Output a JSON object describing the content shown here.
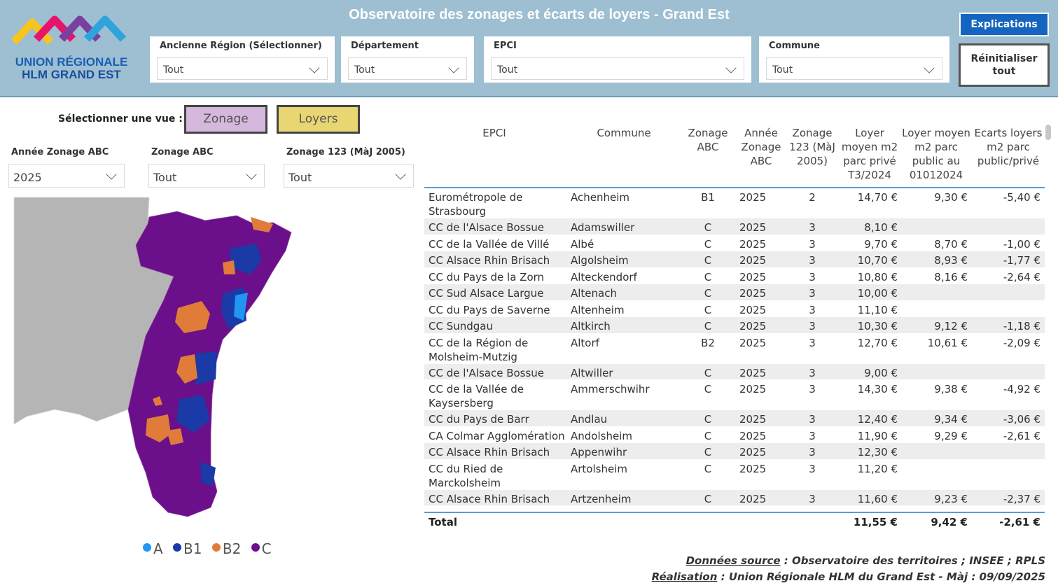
{
  "header": {
    "logo_line1": "UNION RÉGIONALE",
    "logo_line2": "HLM GRAND EST",
    "title": "Observatoire des zonages et écarts de loyers - Grand Est",
    "filters": [
      {
        "label": "Ancienne Région (Sélectionner)",
        "value": "Tout"
      },
      {
        "label": "Département",
        "value": "Tout"
      },
      {
        "label": "EPCI",
        "value": "Tout"
      },
      {
        "label": "Commune",
        "value": "Tout"
      }
    ],
    "explications_label": "Explications",
    "reset_label": "Réinitialiser tout"
  },
  "view": {
    "label": "Sélectionner une vue :",
    "zonage_label": "Zonage",
    "loyers_label": "Loyers"
  },
  "slicers": [
    {
      "label": "Année Zonage ABC",
      "value": "2025"
    },
    {
      "label": "Zonage ABC",
      "value": "Tout"
    },
    {
      "label": "Zonage 123 (MàJ 2005)",
      "value": "Tout"
    }
  ],
  "legend": [
    {
      "label": "A",
      "color": "#2196f3"
    },
    {
      "label": "B1",
      "color": "#1a3aa8"
    },
    {
      "label": "B2",
      "color": "#e07b39"
    },
    {
      "label": "C",
      "color": "#6b0f8a"
    }
  ],
  "table": {
    "headers": {
      "epci": "EPCI",
      "commune": "Commune",
      "zabc": "Zonage ABC",
      "annee": "Année Zonage ABC",
      "z123": "Zonage 123 (MàJ 2005)",
      "lpriv": "Loyer moyen m2 parc privé T3/2024",
      "lpub": "Loyer moyen m2 parc public au 01012024",
      "ecart": "Ecarts loyers m2 parc public/privé"
    },
    "rows": [
      {
        "epci": "Eurométropole de Strasbourg",
        "commune": "Achenheim",
        "zabc": "B1",
        "annee": "2025",
        "z123": "2",
        "lpriv": "14,70 €",
        "lpub": "9,30 €",
        "ecart": "-5,40 €"
      },
      {
        "epci": "CC de l'Alsace Bossue",
        "commune": "Adamswiller",
        "zabc": "C",
        "annee": "2025",
        "z123": "3",
        "lpriv": "8,10 €",
        "lpub": "",
        "ecart": ""
      },
      {
        "epci": "CC de la Vallée de Villé",
        "commune": "Albé",
        "zabc": "C",
        "annee": "2025",
        "z123": "3",
        "lpriv": "9,70 €",
        "lpub": "8,70 €",
        "ecart": "-1,00 €"
      },
      {
        "epci": "CC Alsace Rhin Brisach",
        "commune": "Algolsheim",
        "zabc": "C",
        "annee": "2025",
        "z123": "3",
        "lpriv": "10,70 €",
        "lpub": "8,93 €",
        "ecart": "-1,77 €"
      },
      {
        "epci": "CC du Pays de la Zorn",
        "commune": "Alteckendorf",
        "zabc": "C",
        "annee": "2025",
        "z123": "3",
        "lpriv": "10,80 €",
        "lpub": "8,16 €",
        "ecart": "-2,64 €"
      },
      {
        "epci": "CC Sud Alsace Largue",
        "commune": "Altenach",
        "zabc": "C",
        "annee": "2025",
        "z123": "3",
        "lpriv": "10,00 €",
        "lpub": "",
        "ecart": ""
      },
      {
        "epci": "CC du Pays de Saverne",
        "commune": "Altenheim",
        "zabc": "C",
        "annee": "2025",
        "z123": "3",
        "lpriv": "11,10 €",
        "lpub": "",
        "ecart": ""
      },
      {
        "epci": "CC Sundgau",
        "commune": "Altkirch",
        "zabc": "C",
        "annee": "2025",
        "z123": "3",
        "lpriv": "10,30 €",
        "lpub": "9,12 €",
        "ecart": "-1,18 €"
      },
      {
        "epci": "CC de la Région de Molsheim-Mutzig",
        "commune": "Altorf",
        "zabc": "B2",
        "annee": "2025",
        "z123": "3",
        "lpriv": "12,70 €",
        "lpub": "10,61 €",
        "ecart": "-2,09 €"
      },
      {
        "epci": "CC de l'Alsace Bossue",
        "commune": "Altwiller",
        "zabc": "C",
        "annee": "2025",
        "z123": "3",
        "lpriv": "9,00 €",
        "lpub": "",
        "ecart": ""
      },
      {
        "epci": "CC de la Vallée de Kaysersberg",
        "commune": "Ammerschwihr",
        "zabc": "C",
        "annee": "2025",
        "z123": "3",
        "lpriv": "14,30 €",
        "lpub": "9,38 €",
        "ecart": "-4,92 €"
      },
      {
        "epci": "CC du Pays de Barr",
        "commune": "Andlau",
        "zabc": "C",
        "annee": "2025",
        "z123": "3",
        "lpriv": "12,40 €",
        "lpub": "9,34 €",
        "ecart": "-3,06 €"
      },
      {
        "epci": "CA Colmar Agglomération",
        "commune": "Andolsheim",
        "zabc": "C",
        "annee": "2025",
        "z123": "3",
        "lpriv": "11,90 €",
        "lpub": "9,29 €",
        "ecart": "-2,61 €"
      },
      {
        "epci": "CC Alsace Rhin Brisach",
        "commune": "Appenwihr",
        "zabc": "C",
        "annee": "2025",
        "z123": "3",
        "lpriv": "12,30 €",
        "lpub": "",
        "ecart": ""
      },
      {
        "epci": "CC du Ried de Marckolsheim",
        "commune": "Artolsheim",
        "zabc": "C",
        "annee": "2025",
        "z123": "3",
        "lpriv": "11,20 €",
        "lpub": "",
        "ecart": ""
      },
      {
        "epci": "CC Alsace Rhin Brisach",
        "commune": "Artzenheim",
        "zabc": "C",
        "annee": "2025",
        "z123": "3",
        "lpriv": "11,60 €",
        "lpub": "9,23 €",
        "ecart": "-2,37 €"
      }
    ],
    "total": {
      "label": "Total",
      "lpriv": "11,55 €",
      "lpub": "9,42 €",
      "ecart": "-2,61 €"
    }
  },
  "footer": {
    "source_label": "Données source",
    "source_text": " : Observatoire des territoires ; INSEE ; RPLS",
    "real_label": "Réalisation",
    "real_text": " : Union Régionale HLM du Grand Est - Màj : 09/09/2025"
  }
}
